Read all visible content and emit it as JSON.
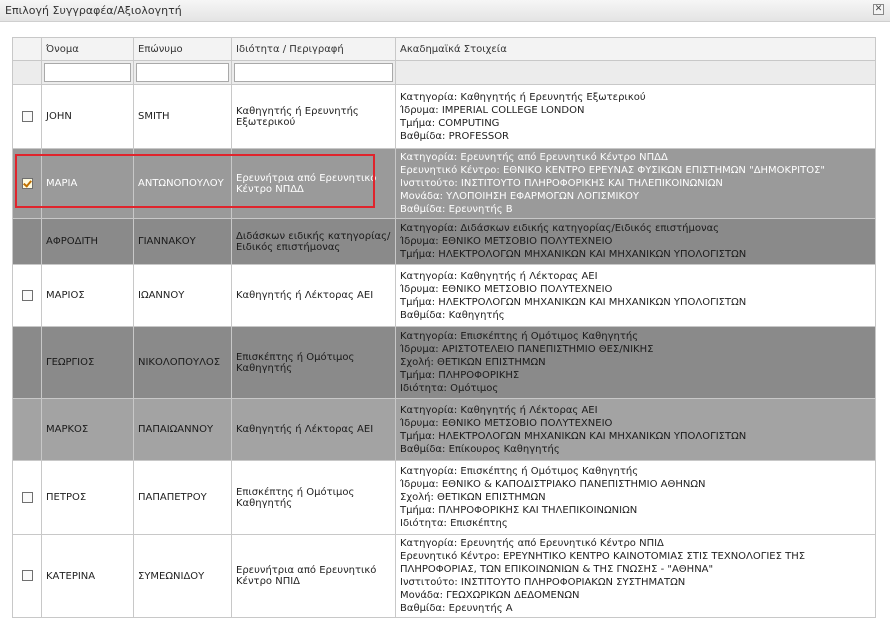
{
  "window": {
    "title": "Επιλογή Συγγραφέα/Αξιολογητή",
    "close_icon": "close-icon"
  },
  "table": {
    "headers": [
      "Όνομα",
      "Επώνυμο",
      "Ιδιότητα / Περιγραφή",
      "Ακαδημαϊκά Στοιχεία"
    ],
    "rows": [
      {
        "style": "white",
        "checkbox": true,
        "checked": false,
        "first": "JOHN",
        "last": "SMITH",
        "role": "Καθηγητής ή Ερευνητής Εξωτερικού",
        "details": [
          "Κατηγορία: Καθηγητής ή Ερευνητής Εξωτερικού",
          "Ίδρυμα: IMPERIAL COLLEGE LONDON",
          "Τμήμα: COMPUTING",
          "Βαθμίδα: PROFESSOR"
        ]
      },
      {
        "style": "sel",
        "checkbox": true,
        "checked": true,
        "first": "ΜΑΡΙΑ",
        "last": "ΑΝΤΩΝΟΠΟΥΛΟΥ",
        "role": "Ερευνήτρια από Ερευνητικό Κέντρο ΝΠΔΔ",
        "details": [
          "Κατηγορία: Ερευνητής από Ερευνητικό Κέντρο ΝΠΔΔ",
          "Ερευνητικό Κέντρο: ΕΘΝΙΚΟ ΚΕΝΤΡΟ ΕΡΕΥΝΑΣ ΦΥΣΙΚΩΝ ΕΠΙΣΤΗΜΩΝ \"ΔΗΜΟΚΡΙΤΟΣ\"",
          "Ινστιτούτο: ΙΝΣΤΙΤΟΥΤΟ ΠΛΗΡΟΦΟΡΙΚΗΣ ΚΑΙ ΤΗΛΕΠΙΚΟΙΝΩΝΙΩΝ",
          "Μονάδα: ΥΛΟΠΟΙΗΣΗ ΕΦΑΡΜΟΓΩΝ ΛΟΓΙΣΜΙΚΟΥ",
          "Βαθμίδα: Ερευνητής Β"
        ]
      },
      {
        "style": "dark",
        "checkbox": false,
        "checked": false,
        "first": "ΑΦΡΟΔΙΤΗ",
        "last": "ΓΙΑΝΝΑΚΟΥ",
        "role": "Διδάσκων ειδικής κατηγορίας/ Ειδικός επιστήμονας",
        "details": [
          "Κατηγορία: Διδάσκων ειδικής κατηγορίας/Ειδικός επιστήμονας",
          "Ίδρυμα: ΕΘΝΙΚΟ ΜΕΤΣΟΒΙΟ ΠΟΛΥΤΕΧΝΕΙΟ",
          "Τμήμα: ΗΛΕΚΤΡΟΛΟΓΩΝ ΜΗΧΑΝΙΚΩΝ ΚΑΙ ΜΗΧΑΝΙΚΩΝ ΥΠΟΛΟΓΙΣΤΩΝ"
        ]
      },
      {
        "style": "white",
        "checkbox": true,
        "checked": false,
        "first": "ΜΑΡΙΟΣ",
        "last": "ΙΩΑΝΝΟΥ",
        "role": "Καθηγητής ή Λέκτορας ΑΕΙ",
        "details": [
          "Κατηγορία: Καθηγητής ή Λέκτορας ΑΕΙ",
          "Ίδρυμα: ΕΘΝΙΚΟ ΜΕΤΣΟΒΙΟ ΠΟΛΥΤΕΧΝΕΙΟ",
          "Τμήμα: ΗΛΕΚΤΡΟΛΟΓΩΝ ΜΗΧΑΝΙΚΩΝ ΚΑΙ ΜΗΧΑΝΙΚΩΝ ΥΠΟΛΟΓΙΣΤΩΝ",
          "Βαθμίδα: Καθηγητής"
        ]
      },
      {
        "style": "dark",
        "checkbox": false,
        "checked": false,
        "first": "ΓΕΩΡΓΙΟΣ",
        "last": "ΝΙΚΟΛΟΠΟΥΛΟΣ",
        "role": "Επισκέπτης ή Ομότιμος Καθηγητής",
        "details": [
          "Κατηγορία: Επισκέπτης ή Ομότιμος Καθηγητής",
          "Ίδρυμα: ΑΡΙΣΤΟΤΕΛΕΙΟ ΠΑΝΕΠΙΣΤΗΜΙΟ ΘΕΣ/ΝΙΚΗΣ",
          "Σχολή: ΘΕΤΙΚΩΝ ΕΠΙΣΤΗΜΩΝ",
          "Τμήμα: ΠΛΗΡΟΦΟΡΙΚΗΣ",
          "Ιδιότητα: Ομότιμος"
        ]
      },
      {
        "style": "mid",
        "checkbox": false,
        "checked": false,
        "first": "ΜΑΡΚΟΣ",
        "last": "ΠΑΠΑΙΩΑΝΝΟΥ",
        "role": "Καθηγητής ή Λέκτορας ΑΕΙ",
        "details": [
          "Κατηγορία: Καθηγητής ή Λέκτορας ΑΕΙ",
          "Ίδρυμα: ΕΘΝΙΚΟ ΜΕΤΣΟΒΙΟ ΠΟΛΥΤΕΧΝΕΙΟ",
          "Τμήμα: ΗΛΕΚΤΡΟΛΟΓΩΝ ΜΗΧΑΝΙΚΩΝ ΚΑΙ ΜΗΧΑΝΙΚΩΝ ΥΠΟΛΟΓΙΣΤΩΝ",
          "Βαθμίδα: Επίκουρος Καθηγητής"
        ]
      },
      {
        "style": "white",
        "checkbox": true,
        "checked": false,
        "first": "ΠΕΤΡΟΣ",
        "last": "ΠΑΠΑΠΕΤΡΟΥ",
        "role": "Επισκέπτης ή Ομότιμος Καθηγητής",
        "details": [
          "Κατηγορία: Επισκέπτης ή Ομότιμος Καθηγητής",
          "Ίδρυμα: ΕΘΝΙΚΟ & ΚΑΠΟΔΙΣΤΡΙΑΚΟ ΠΑΝΕΠΙΣΤΗΜΙΟ ΑΘΗΝΩΝ",
          "Σχολή: ΘΕΤΙΚΩΝ ΕΠΙΣΤΗΜΩΝ",
          "Τμήμα: ΠΛΗΡΟΦΟΡΙΚΗΣ ΚΑΙ ΤΗΛΕΠΙΚΟΙΝΩΝΙΩΝ",
          "Ιδιότητα: Επισκέπτης"
        ]
      },
      {
        "style": "white",
        "checkbox": true,
        "checked": false,
        "first": "ΚΑΤΕΡΙΝΑ",
        "last": "ΣΥΜΕΩΝΙΔΟΥ",
        "role": "Ερευνήτρια από Ερευνητικό Κέντρο ΝΠΙΔ",
        "details": [
          "Κατηγορία: Ερευνητής από Ερευνητικό Κέντρο ΝΠΙΔ",
          "Ερευνητικό Κέντρο: ΕΡΕΥΝΗΤΙΚΟ ΚΕΝΤΡΟ ΚΑΙΝΟΤΟΜΙΑΣ ΣΤΙΣ ΤΕΧΝΟΛΟΓΙΕΣ ΤΗΣ",
          "ΠΛΗΡΟΦΟΡΙΑΣ, ΤΩΝ ΕΠΙΚΟΙΝΩΝΙΩΝ & ΤΗΣ ΓΝΩΣΗΣ - \"ΑΘΗΝΑ\"",
          "Ινστιτούτο: ΙΝΣΤΙΤΟΥΤΟ ΠΛΗΡΟΦΟΡΙΑΚΩΝ ΣΥΣΤΗΜΑΤΩΝ",
          "Μονάδα: ΓΕΩΧΩΡΙΚΩΝ ΔΕΔΟΜΕΝΩΝ",
          "Βαθμίδα: Ερευνητής Α"
        ]
      }
    ]
  },
  "colors": {
    "highlight": "#e0242c",
    "selected_row": "#9a9a9a",
    "disabled_row": "#8a8a8a"
  }
}
